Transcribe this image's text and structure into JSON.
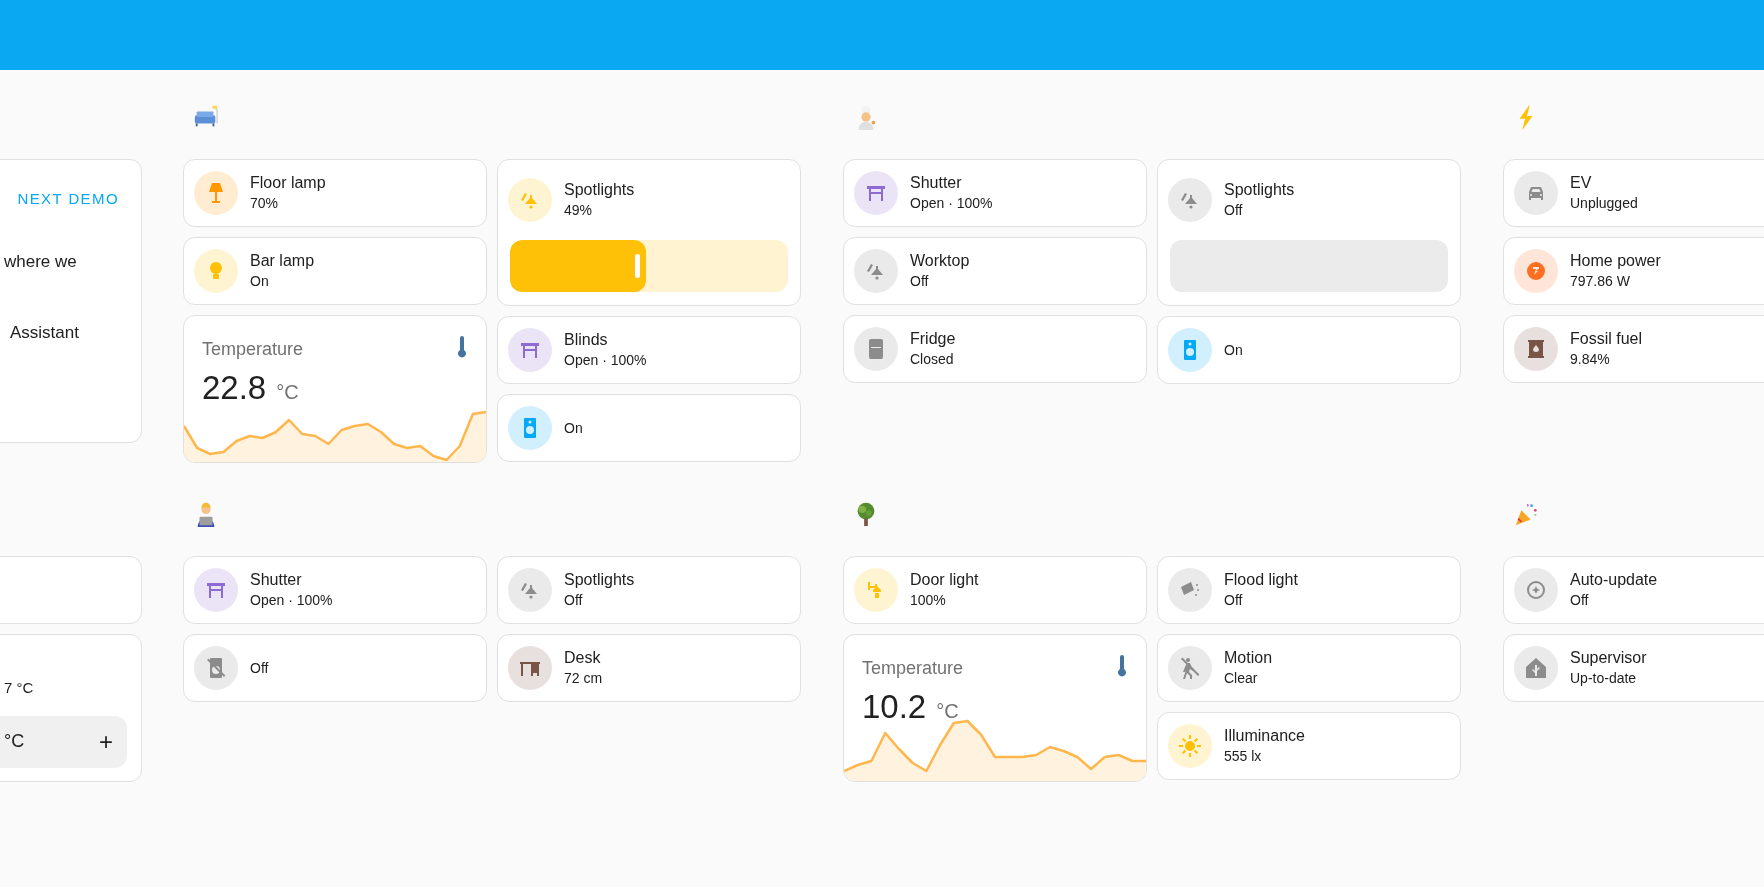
{
  "rows": [
    {
      "sections": [
        {
          "columns": [
            [
              {
                "kind": "intro",
                "lines": [
                  "where we",
                  "Assistant"
                ],
                "button": "NEXT DEMO"
              }
            ]
          ]
        },
        {
          "columns": [
            [
              {
                "kind": "tile",
                "name": "Floor lamp",
                "state": "70%",
                "color": "#ff9800"
              },
              {
                "kind": "tile",
                "name": "Bar lamp",
                "state": "On",
                "color": "#ffc107"
              },
              {
                "kind": "sensor",
                "name": "Temperature",
                "value": "22.8",
                "unit": "°C"
              }
            ],
            [
              {
                "kind": "slider",
                "name": "Spotlights",
                "state": "49%",
                "color": "#ffc107",
                "disabled": false
              },
              {
                "kind": "tile",
                "name": "Blinds",
                "state": "Open · 100%",
                "color": "#8e6bd4"
              },
              {
                "kind": "tile",
                "state": "On",
                "color": "#03a9f4"
              }
            ]
          ]
        },
        {
          "columns": [
            [
              {
                "kind": "tile",
                "name": "Shutter",
                "state": "Open · 100%",
                "color": "#8e6bd4"
              },
              {
                "kind": "tile",
                "name": "Worktop",
                "state": "Off",
                "color": "#8c8c8c"
              },
              {
                "kind": "tile",
                "name": "Fridge",
                "state": "Closed",
                "color": "#8c8c8c"
              }
            ],
            [
              {
                "kind": "slider",
                "name": "Spotlights",
                "state": "Off",
                "color": "#8c8c8c",
                "disabled": true
              },
              {
                "kind": "tile",
                "state": "On",
                "color": "#03a9f4"
              }
            ]
          ]
        },
        {
          "columns": [
            [
              {
                "kind": "tile",
                "name": "EV",
                "state": "Unplugged",
                "color": "#8c8c8c"
              },
              {
                "kind": "tile",
                "name": "Home power",
                "state": "797.86 W",
                "color": "#ff6f22"
              },
              {
                "kind": "tile",
                "name": "Fossil fuel",
                "state": "9.84%",
                "color": "#795548"
              }
            ]
          ]
        }
      ]
    },
    {
      "sections": [
        {
          "columns": [
            [
              {
                "kind": "blank"
              },
              {
                "kind": "thermostat",
                "reading": "7 °C",
                "field": "°C",
                "button": "+"
              }
            ]
          ]
        },
        {
          "columns": [
            [
              {
                "kind": "tile",
                "name": "Shutter",
                "state": "Open · 100%",
                "color": "#8e6bd4"
              },
              {
                "kind": "tile",
                "state": "Off",
                "color": "#8c8c8c"
              }
            ],
            [
              {
                "kind": "tile",
                "name": "Spotlights",
                "state": "Off",
                "color": "#8c8c8c"
              },
              {
                "kind": "tile",
                "name": "Desk",
                "state": "72 cm",
                "color": "#795548"
              }
            ]
          ]
        },
        {
          "columns": [
            [
              {
                "kind": "tile",
                "name": "Door light",
                "state": "100%",
                "color": "#ffc107"
              },
              {
                "kind": "sensor",
                "name": "Temperature",
                "value": "10.2",
                "unit": "°C"
              }
            ],
            [
              {
                "kind": "tile",
                "name": "Flood light",
                "state": "Off",
                "color": "#8c8c8c"
              },
              {
                "kind": "tile",
                "name": "Motion",
                "state": "Clear",
                "color": "#8c8c8c"
              },
              {
                "kind": "tile",
                "name": "Illuminance",
                "state": "555 lx",
                "color": "#ffc107"
              }
            ]
          ]
        },
        {
          "columns": [
            [
              {
                "kind": "tile",
                "name": "Auto-update",
                "state": "Off",
                "color": "#8c8c8c"
              },
              {
                "kind": "tile",
                "name": "Supervisor",
                "state": "Up-to-date",
                "color": "#8c8c8c"
              }
            ]
          ]
        }
      ]
    }
  ]
}
